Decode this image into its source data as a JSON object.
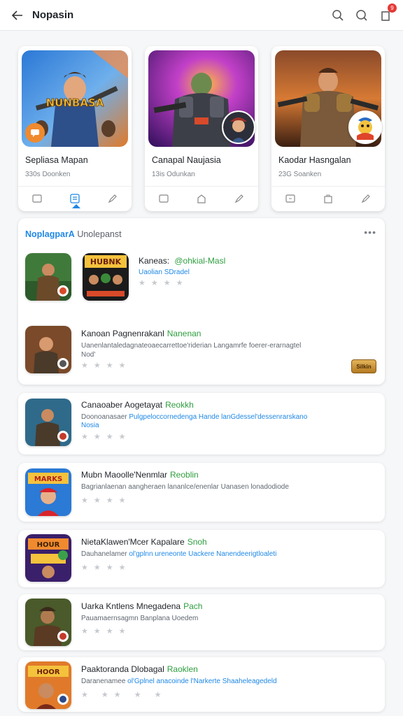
{
  "header": {
    "title": "Nopasin",
    "badge_count": "9"
  },
  "featured": [
    {
      "name": "Sepliasa Mapan",
      "meta": "330s Doonken",
      "overlay": "play"
    },
    {
      "name": "Canapal Naujasia",
      "meta": "13is Odunkan",
      "overlay": "avatar"
    },
    {
      "name": "Kaodar Hasngalan",
      "meta": "23G Soanken",
      "overlay": "avatar"
    }
  ],
  "section": {
    "title_a": "NoplagparA",
    "title_b": "Unolepanst",
    "more": "•••"
  },
  "list": [
    {
      "name": "Kaneas: ",
      "tag": "@ohkial-Masl",
      "desc": "Uaolian SDradel",
      "desc_blue": true,
      "desc2": ""
    },
    {
      "name": "Kanoan Pagnenrakanl",
      "tag": "Nanenan",
      "desc": "Uanenlantaledagnateoaecarrettoe'riderian Langamrfe foerer-erarnagtel",
      "desc_blue": false,
      "desc2": "Nod'",
      "button": "Silkin"
    },
    {
      "name": "Canaoaber Aogetayat",
      "tag": "Reokkh",
      "desc": "Doonoanasaer ",
      "desc_b": "Pulgpeloccornedenga Hande lanGdessel'dessenrarskano",
      "desc2": "Nosia"
    },
    {
      "name": "Mubn Maoolle'Nenmlar",
      "tag": "Reoblin",
      "desc": "Bagrianlaenan aangheraen lananlce/enenlar Uanasen lonadodiode",
      "desc_blue": false,
      "desc2": ""
    },
    {
      "name": "NietaKlawen'Mcer Kapalare",
      "tag": "Snoh",
      "desc": "Dauhanelamer ",
      "desc_b": "ol'gplnn ureneonte Uackere Nanendeerigtloaleti",
      "desc2": ""
    },
    {
      "name": "Uarka Kntlens Mnegadena",
      "tag": "Pach",
      "desc": "Pauamaernsagmn Banplana Uoedem",
      "desc_blue": false,
      "desc2": ""
    },
    {
      "name": "Paaktoranda Dlobagal",
      "tag": "Raoklen",
      "desc": "Daranenamee ",
      "desc_b": "ol'Gplnel anacoinde l'Narkerte Shaaheleagedeld",
      "desc2": ""
    }
  ],
  "stars_glyph": "★★★★",
  "stars_glyph_5": "★ ★★ ★ ★",
  "colors": {
    "accent": "#1f88e5",
    "tag_green": "#2e9e3f",
    "badge_red": "#e53935",
    "play_orange": "#f08a2f"
  },
  "icons": [
    "back-arrow-icon",
    "search-icon",
    "chat-icon",
    "notification-icon",
    "bookmark-icon",
    "save-icon",
    "share-icon",
    "store-icon",
    "more-icon"
  ]
}
